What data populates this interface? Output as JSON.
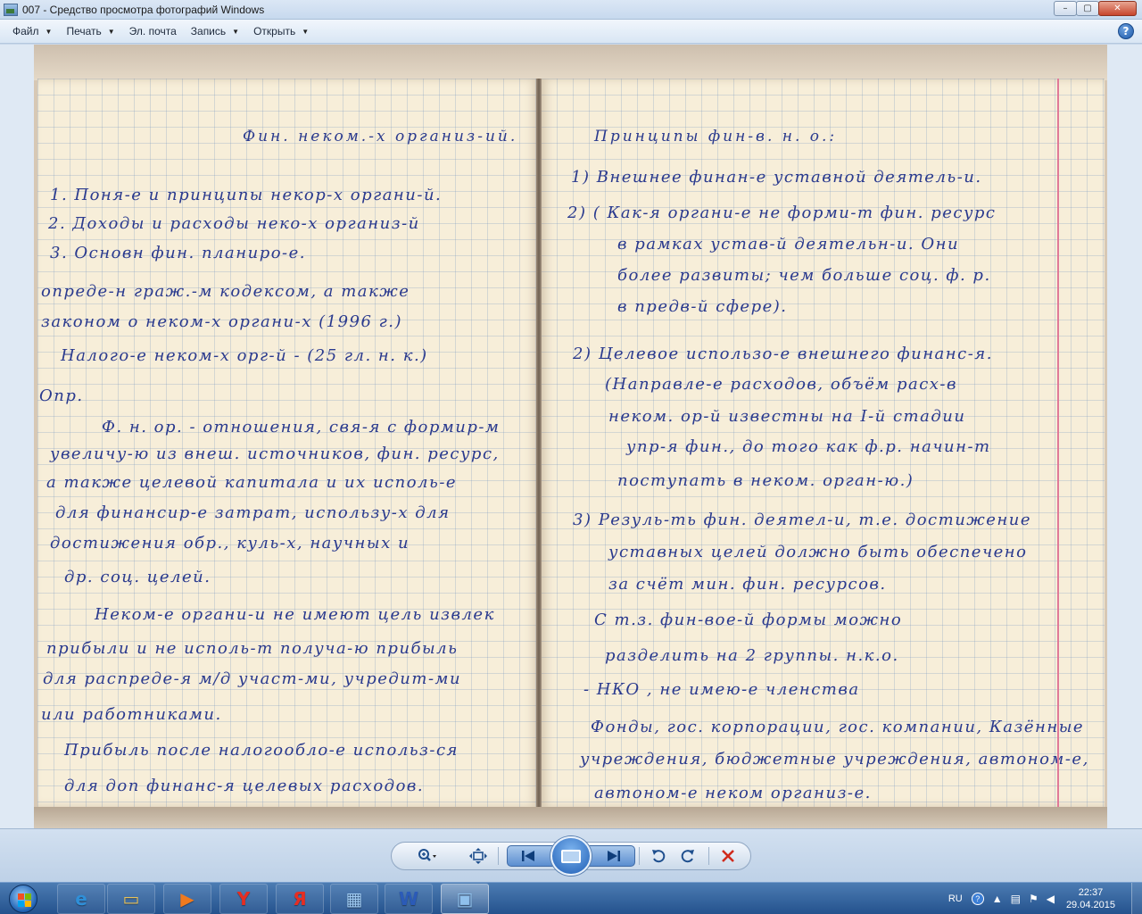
{
  "window": {
    "title": "007 - Средство просмотра фотографий Windows",
    "controls": {
      "minimize": "–",
      "maximize": "▢",
      "close": "✕"
    }
  },
  "menu": {
    "items": [
      {
        "label": "Файл",
        "has_dropdown": true
      },
      {
        "label": "Печать",
        "has_dropdown": true
      },
      {
        "label": "Эл. почта",
        "has_dropdown": false
      },
      {
        "label": "Запись",
        "has_dropdown": true
      },
      {
        "label": "Открыть",
        "has_dropdown": true
      }
    ],
    "help": "?"
  },
  "photo": {
    "left_page": [
      "Фин. неком.-х организ-ий.",
      "1. Поня-е и принципы некор-х органи-й.",
      "2. Доходы и расходы неко-х организ-й",
      "3. Основн фин. планиро-е.",
      "опреде-н граж.-м кодексом, а также",
      "законом о неком-х органи-х (1996 г.)",
      "Налого-е неком-х орг-й - (25 гл. н. к.)",
      "Опр.",
      "Ф. н. ор. - отношения, свя-я с формир-м",
      "увеличу-ю из внеш. источников, фин. ресурс,",
      "а также целевой капитала и их исполь-е",
      "для финансир-е затрат, использу-х для",
      "достижения обр., куль-х, научных и",
      "др. соц. целей.",
      "Неком-е органи-и не имеют цель извлек",
      "прибыли и не исполь-т получа-ю прибыль",
      "для распреде-я м/д участ-ми, учредит-ми",
      "или работниками.",
      "Прибыль после налогообло-е использ-ся",
      "для доп финанс-я целевых расходов."
    ],
    "right_page": [
      "Принципы фин-в. н. о.:",
      "1) Внешнее финан-е уставной деятель-и.",
      "2) ( Как-я органи-е не форми-т фин. ресурс",
      "в рамках устав-й деятельн-и. Они",
      "более развиты; чем больше соц. ф. р.",
      "в предв-й сфере).",
      "2) Целевое использо-е внешнего финанс-я.",
      "(Направле-е расходов, объём расх-в",
      "неком. ор-й известны на I-й стадии",
      "упр-я фин., до того как ф.р. начин-т",
      "поступать в неком. орган-ю.)",
      "3) Резуль-ть фин. деятел-и, т.е. достижение",
      "уставных целей должно быть обеспечено",
      "за счёт мин. фин. ресурсов.",
      "С т.з. фин-вое-й формы можно",
      "разделить на 2 группы. н.к.о.",
      "- НКО , не имею-е членства",
      "Фонды, гос. корпорации, гос. компании, Казённые",
      "учреждения, бюджетные учреждения, автоном-е,",
      "автоном-е неком организ-е."
    ]
  },
  "toolbar": {
    "zoom_icon": "magnifier-icon",
    "fit_icon": "fit-window-icon",
    "previous_icon": "previous-icon",
    "slideshow_icon": "slideshow-icon",
    "next_icon": "next-icon",
    "rotate_left_icon": "rotate-ccw-icon",
    "rotate_right_icon": "rotate-cw-icon",
    "delete_icon": "delete-icon"
  },
  "taskbar": {
    "apps": [
      {
        "name": "internet-explorer",
        "glyph": "e",
        "color": "#2f8fd8",
        "active": false
      },
      {
        "name": "file-explorer",
        "glyph": "▭",
        "color": "#e8c25a",
        "active": false
      },
      {
        "name": "media-player",
        "glyph": "▶",
        "color": "#f07a1f",
        "active": false
      },
      {
        "name": "yandex-browser",
        "glyph": "Y",
        "color": "#e62d22",
        "active": false
      },
      {
        "name": "yandex",
        "glyph": "Я",
        "color": "#e62d22",
        "active": false
      },
      {
        "name": "control-panel",
        "glyph": "▦",
        "color": "#9ec9f0",
        "active": false
      },
      {
        "name": "word",
        "glyph": "W",
        "color": "#2b5bb8",
        "active": false
      },
      {
        "name": "photo-viewer",
        "glyph": "▣",
        "color": "#8fc0ec",
        "active": true
      }
    ],
    "tray": {
      "language": "RU",
      "time": "22:37",
      "date": "29.04.2015"
    }
  }
}
